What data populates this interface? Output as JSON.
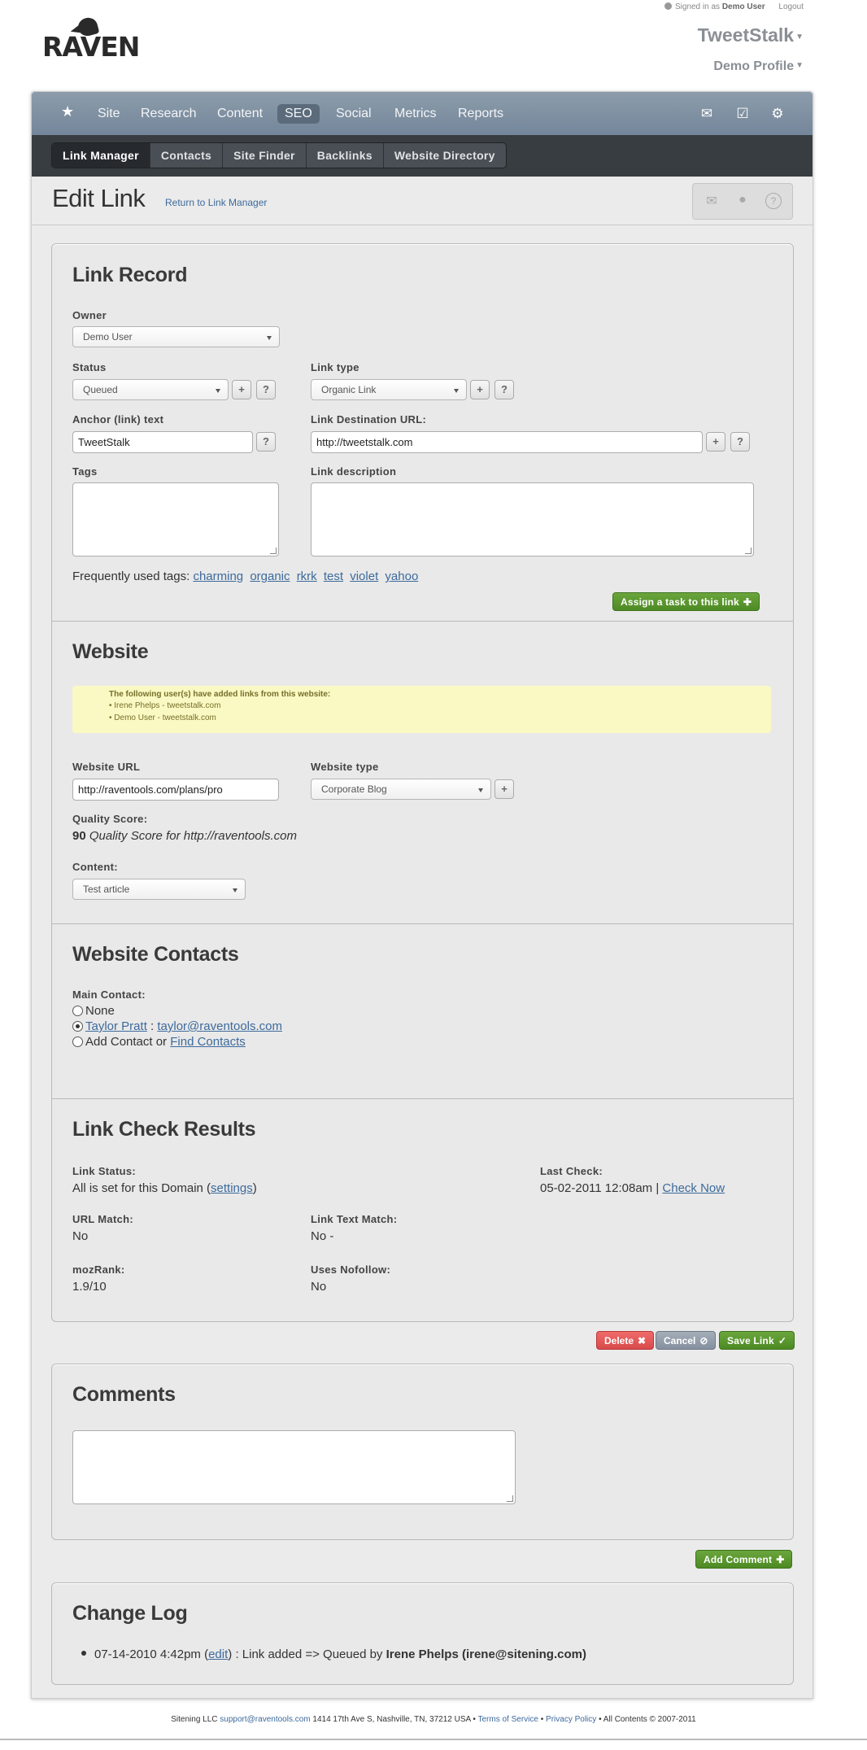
{
  "header": {
    "signed_in_prefix": "Signed in as",
    "signed_in_user": "Demo User",
    "logout": "Logout",
    "logo_text": "RAVEN",
    "project": "TweetStalk",
    "profile": "Demo Profile"
  },
  "main_nav": {
    "items": [
      "Site",
      "Research",
      "Content",
      "SEO",
      "Social",
      "Metrics",
      "Reports"
    ],
    "active": "SEO"
  },
  "sub_nav": {
    "tabs": [
      "Link Manager",
      "Contacts",
      "Site Finder",
      "Backlinks",
      "Website Directory"
    ],
    "active": "Link Manager"
  },
  "page": {
    "title": "Edit Link",
    "return_link": "Return to Link Manager"
  },
  "link_record": {
    "heading": "Link Record",
    "owner_label": "Owner",
    "owner_value": "Demo User",
    "status_label": "Status",
    "status_value": "Queued",
    "link_type_label": "Link type",
    "link_type_value": "Organic Link",
    "anchor_label": "Anchor (link) text",
    "anchor_value": "TweetStalk",
    "dest_label": "Link Destination URL:",
    "dest_value": "http://tweetstalk.com",
    "tags_label": "Tags",
    "description_label": "Link description",
    "freq_tags_label": "Frequently used tags:",
    "freq_tags": [
      "charming",
      "organic",
      "rkrk",
      "test",
      "violet",
      "yahoo"
    ],
    "assign_task_button": "Assign a task to this link"
  },
  "website": {
    "heading": "Website",
    "notice_title": "The following user(s) have added links from this website:",
    "notice_items": [
      "Irene Phelps - tweetstalk.com",
      "Demo User - tweetstalk.com"
    ],
    "url_label": "Website URL",
    "url_value": "http://raventools.com/plans/pro",
    "type_label": "Website type",
    "type_value": "Corporate Blog",
    "quality_label": "Quality Score:",
    "quality_score": "90",
    "quality_text": "Quality Score for http://raventools.com",
    "content_label": "Content:",
    "content_value": "Test article"
  },
  "contacts": {
    "heading": "Website Contacts",
    "main_contact_label": "Main Contact:",
    "option_none": "None",
    "contact_name": "Taylor Pratt",
    "contact_sep": " : ",
    "contact_email": "taylor@raventools.com",
    "add_contact": "Add Contact or",
    "find_contacts": "Find Contacts"
  },
  "link_check": {
    "heading": "Link Check Results",
    "status_label": "Link Status:",
    "status_text": "All is set for this Domain (",
    "settings_link": "settings",
    "status_close": ")",
    "last_check_label": "Last Check:",
    "last_check_value": "05-02-2011 12:08am |",
    "check_now": "Check Now",
    "url_match_label": "URL Match:",
    "url_match_value": "No",
    "text_match_label": "Link Text Match:",
    "text_match_value": "No -",
    "mozrank_label": "mozRank:",
    "mozrank_value": "1.9/10",
    "nofollow_label": "Uses Nofollow:",
    "nofollow_value": "No"
  },
  "actions": {
    "delete": "Delete",
    "cancel": "Cancel",
    "save": "Save Link"
  },
  "comments": {
    "heading": "Comments",
    "add_button": "Add Comment"
  },
  "change_log": {
    "heading": "Change Log",
    "entry_date": "07-14-2010 4:42pm (",
    "entry_edit": "edit",
    "entry_mid": ") : Link added => Queued by",
    "entry_user": "Irene Phelps (irene@sitening.com)"
  },
  "footer": {
    "company": "Sitening LLC",
    "email": "support@raventools.com",
    "address": "1414 17th Ave S, Nashville, TN, 37212 USA •",
    "terms": "Terms of Service",
    "bullet": "•",
    "privacy": "Privacy Policy",
    "copyright": "• All Contents © 2007-2011"
  },
  "colors": {
    "nav": "#7e8fa2",
    "subnav": "#383d42",
    "green_button": "#5a9630",
    "red_button": "#e25858",
    "link": "#3d6a9c",
    "notice_bg": "#fbf9c3"
  }
}
